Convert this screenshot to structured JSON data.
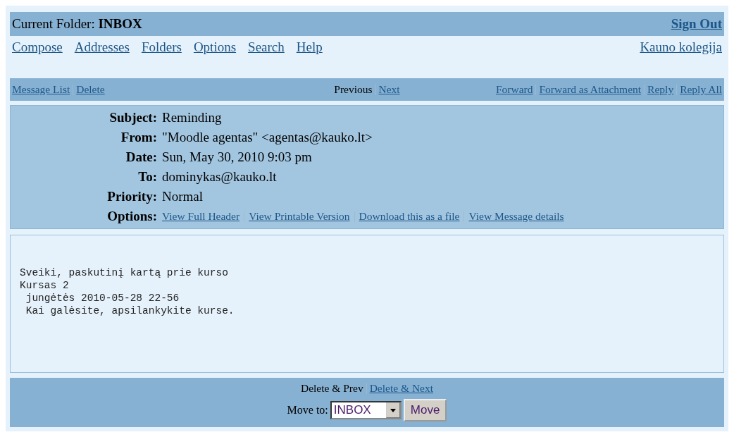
{
  "current_folder": {
    "label": "Current Folder:",
    "name": "INBOX"
  },
  "sign_out": "Sign Out",
  "menu": [
    "Compose",
    "Addresses",
    "Folders",
    "Options",
    "Search",
    "Help"
  ],
  "org_link": "Kauno kolegija",
  "toolbar": {
    "left": [
      {
        "label": "Message List",
        "disabled": false
      },
      {
        "label": "Delete",
        "disabled": false
      }
    ],
    "center": [
      {
        "label": "Previous",
        "disabled": true
      },
      {
        "label": "Next",
        "disabled": false
      }
    ],
    "right": [
      {
        "label": "Forward",
        "disabled": false
      },
      {
        "label": "Forward as Attachment",
        "disabled": false
      },
      {
        "label": "Reply",
        "disabled": false
      },
      {
        "label": "Reply All",
        "disabled": false
      }
    ]
  },
  "headers": [
    {
      "label": "Subject:",
      "value": "Reminding"
    },
    {
      "label": "From:",
      "value": "\"Moodle agentas\" <agentas@kauko.lt>"
    },
    {
      "label": "Date:",
      "value": "Sun, May 30, 2010 9:03 pm"
    },
    {
      "label": "To:",
      "value": "dominykas@kauko.lt"
    },
    {
      "label": "Priority:",
      "value": "Normal"
    }
  ],
  "options": {
    "label": "Options:",
    "links": [
      "View Full Header",
      "View Printable Version",
      "Download this as a file",
      "View Message details"
    ]
  },
  "body": [
    "Sveiki, paskutinį kartą prie kurso",
    "Kursas 2",
    " jungėtės 2010-05-28 22-56",
    " Kai galėsite, apsilankykite kurse."
  ],
  "bottom": {
    "links": [
      {
        "label": "Delete & Prev",
        "disabled": true
      },
      {
        "label": "Delete & Next",
        "disabled": false
      }
    ],
    "move_label": "Move to:",
    "folder": "INBOX",
    "move_button": "Move"
  }
}
